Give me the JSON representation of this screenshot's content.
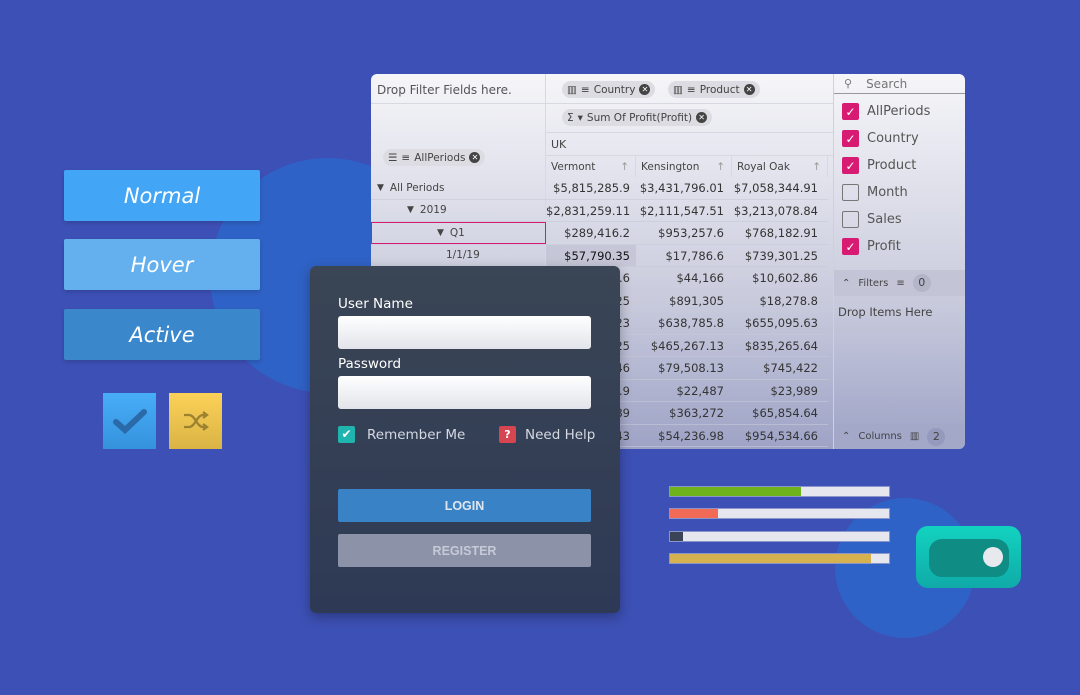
{
  "colors": {
    "background": "#3d50b5",
    "accent": "#d81b72",
    "normal": "#42a5f5",
    "hover": "#64b5f6",
    "active": "#3a8ad0",
    "toggle": "#14c8b8"
  },
  "state_buttons": [
    {
      "label": "Normal"
    },
    {
      "label": "Hover"
    },
    {
      "label": "Active"
    }
  ],
  "tiles": [
    {
      "icon": "check-icon"
    },
    {
      "icon": "shuffle-icon"
    }
  ],
  "pivot": {
    "filter_placeholder": "Drop Filter Fields here.",
    "column_chips": [
      {
        "label": "Country"
      },
      {
        "label": "Product"
      }
    ],
    "value_chip": {
      "label": "Sum Of Profit(Profit)"
    },
    "row_chip": {
      "label": "AllPeriods"
    },
    "country_header": "UK",
    "columns": [
      "Vermont",
      "Kensington",
      "Royal Oak"
    ],
    "rows": [
      {
        "label": "All Periods",
        "level": 0,
        "expander": true,
        "values": [
          "$5,815,285.9",
          "$3,431,796.01",
          "$7,058,344.91"
        ]
      },
      {
        "label": "2019",
        "level": 1,
        "expander": true,
        "values": [
          "$2,831,259.11",
          "$2,111,547.51",
          "$3,213,078.84"
        ]
      },
      {
        "label": "Q1",
        "level": 2,
        "expander": true,
        "selected": true,
        "values": [
          "$289,416.2",
          "$953,257.6",
          "$768,182.91"
        ]
      },
      {
        "label": "1/1/19",
        "level": 3,
        "values": [
          "$57,790.35",
          "$17,786.6",
          "$739,301.25"
        ]
      },
      {
        "label": "",
        "values": [
          "7.6",
          "$44,166",
          "$10,602.86"
        ]
      },
      {
        "label": "",
        "values": [
          ".25",
          "$891,305",
          "$18,278.8"
        ]
      },
      {
        "label": "",
        "values": [
          ".23",
          "$638,785.8",
          "$655,095.63"
        ]
      },
      {
        "label": "",
        "values": [
          ".25",
          "$465,267.13",
          "$835,265.64"
        ]
      },
      {
        "label": "",
        "values": [
          ".46",
          "$79,508.13",
          "$745,422"
        ]
      },
      {
        "label": "",
        "values": [
          "4.9",
          "$22,487",
          "$23,989"
        ]
      },
      {
        "label": "",
        "values": [
          ".89",
          "$363,272",
          "$65,854.64"
        ]
      },
      {
        "label": "",
        "values": [
          ".43",
          "$54,236.98",
          "$954,534.66"
        ]
      }
    ],
    "field_list": {
      "search_placeholder": "Search",
      "fields": [
        {
          "label": "AllPeriods",
          "checked": true
        },
        {
          "label": "Country",
          "checked": true
        },
        {
          "label": "Product",
          "checked": true
        },
        {
          "label": "Month",
          "checked": false
        },
        {
          "label": "Sales",
          "checked": false
        },
        {
          "label": "Profit",
          "checked": true
        }
      ],
      "filters_label": "Filters",
      "filters_count": "0",
      "drop_text": "Drop Items Here",
      "columns_label": "Columns",
      "columns_count": "2"
    }
  },
  "login": {
    "username_label": "User Name",
    "username_value": "",
    "password_label": "Password",
    "password_value": "",
    "remember_label": "Remember Me",
    "remember_checked": true,
    "help_label": "Need Help",
    "login_label": "LOGIN",
    "register_label": "REGISTER"
  },
  "progress": [
    {
      "percent": 60,
      "color": "#6fb31c"
    },
    {
      "percent": 22,
      "color": "#f06a55"
    },
    {
      "percent": 6,
      "color": "#3a4456"
    },
    {
      "percent": 92,
      "color": "#d5b150"
    }
  ],
  "toggle": {
    "on": true
  }
}
